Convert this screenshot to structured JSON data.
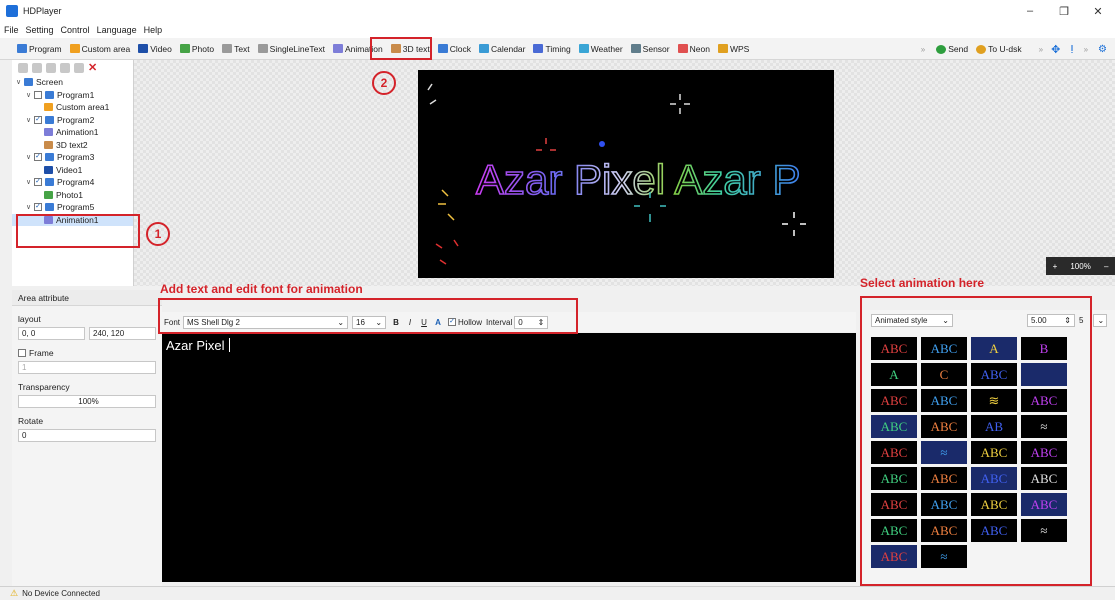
{
  "window": {
    "title": "HDPlayer",
    "minimize": "–",
    "maximize": "❐",
    "close": "✕"
  },
  "menu": [
    "File",
    "Setting",
    "Control",
    "Language",
    "Help"
  ],
  "toolbar": [
    {
      "label": "Program",
      "color": "#3a7bd5"
    },
    {
      "label": "Custom area",
      "color": "#f0a020"
    },
    {
      "label": "Video",
      "color": "#1e4fa8"
    },
    {
      "label": "Photo",
      "color": "#46a346"
    },
    {
      "label": "Text",
      "color": "#9a9a9a"
    },
    {
      "label": "SingleLineText",
      "color": "#9a9a9a"
    },
    {
      "label": "Animation",
      "color": "#7d7dd8"
    },
    {
      "label": "3D text",
      "color": "#c98b4a"
    },
    {
      "label": "Clock",
      "color": "#3a7bd5"
    },
    {
      "label": "Calendar",
      "color": "#3a9bd5"
    },
    {
      "label": "Timing",
      "color": "#4a6ad5"
    },
    {
      "label": "Weather",
      "color": "#3aa5d5"
    },
    {
      "label": "Sensor",
      "color": "#607d8b"
    },
    {
      "label": "Neon",
      "color": "#e05050"
    },
    {
      "label": "WPS",
      "color": "#e0a020"
    }
  ],
  "toolbar_right": [
    {
      "label": "Send",
      "color": "#2e9e3e"
    },
    {
      "label": "To U-dsk",
      "color": "#e0a020"
    }
  ],
  "tree": [
    {
      "label": "Screen",
      "level": 0,
      "chevron": "∨",
      "check": false,
      "icon": "#3a7bd5",
      "selected": false
    },
    {
      "label": "Program1",
      "level": 1,
      "chevron": "∨",
      "check": "empty",
      "icon": "#3a7bd5",
      "selected": false
    },
    {
      "label": "Custom area1",
      "level": 2,
      "chevron": "",
      "check": false,
      "icon": "#f0a020",
      "selected": false
    },
    {
      "label": "Program2",
      "level": 1,
      "chevron": "∨",
      "check": "checked",
      "icon": "#3a7bd5",
      "selected": false
    },
    {
      "label": "Animation1",
      "level": 2,
      "chevron": "",
      "check": false,
      "icon": "#7d7dd8",
      "selected": false
    },
    {
      "label": "3D text2",
      "level": 2,
      "chevron": "",
      "check": false,
      "icon": "#c98b4a",
      "selected": false
    },
    {
      "label": "Program3",
      "level": 1,
      "chevron": "∨",
      "check": "checked",
      "icon": "#3a7bd5",
      "selected": false
    },
    {
      "label": "Video1",
      "level": 2,
      "chevron": "",
      "check": false,
      "icon": "#1e4fa8",
      "selected": false
    },
    {
      "label": "Program4",
      "level": 1,
      "chevron": "∨",
      "check": "checked",
      "icon": "#3a7bd5",
      "selected": false
    },
    {
      "label": "Photo1",
      "level": 2,
      "chevron": "",
      "check": false,
      "icon": "#46a346",
      "selected": false
    },
    {
      "label": "Program5",
      "level": 1,
      "chevron": "∨",
      "check": "checked",
      "icon": "#3a7bd5",
      "selected": false
    },
    {
      "label": "Animation1",
      "level": 2,
      "chevron": "",
      "check": false,
      "icon": "#7d7dd8",
      "selected": true
    }
  ],
  "preview": {
    "text": "Azar Pixel  Azar P"
  },
  "zoom": {
    "plus": "+",
    "value": "100%",
    "minus": "–"
  },
  "attributes": {
    "header": "Area attribute",
    "layout_label": "layout",
    "position": "0, 0",
    "size": "240, 120",
    "frame_label": "Frame",
    "frame_value": "1",
    "transparency_label": "Transparency",
    "transparency_value": "100%",
    "rotate_label": "Rotate",
    "rotate_value": "0"
  },
  "font_toolbar": {
    "font_label": "Font",
    "font_value": "MS Shell Dlg 2",
    "size_value": "16",
    "bold": "B",
    "italic": "I",
    "underline": "U",
    "color_btn": "A",
    "hollow_label": "Hollow",
    "interval_label": "Interval",
    "interval_value": "0"
  },
  "editor": {
    "text": "Azar Pixel"
  },
  "anim": {
    "style_label": "Animated style",
    "speed_value": "5.00",
    "count_value": "5",
    "tiles": [
      "ABC",
      "ABC",
      "A",
      "B",
      "A",
      "C",
      "ABC",
      "",
      "ABC",
      "ABC",
      "≋",
      "ABC",
      "ABC",
      "ABC",
      "AB",
      "≈",
      "ABC",
      "≈",
      "ABC",
      "ABC",
      "ABC",
      "ABC",
      "ABC",
      "ABC",
      "ABC",
      "ABC",
      "ABC",
      "ABC",
      "ABC",
      "ABC",
      "ABC",
      "≈",
      "ABC",
      "≈"
    ]
  },
  "annotations": {
    "step1": "1",
    "step2": "2",
    "font_hint": "Add text and edit font for animation",
    "anim_hint": "Select animation here"
  },
  "status": {
    "text": "No Device Connected"
  }
}
